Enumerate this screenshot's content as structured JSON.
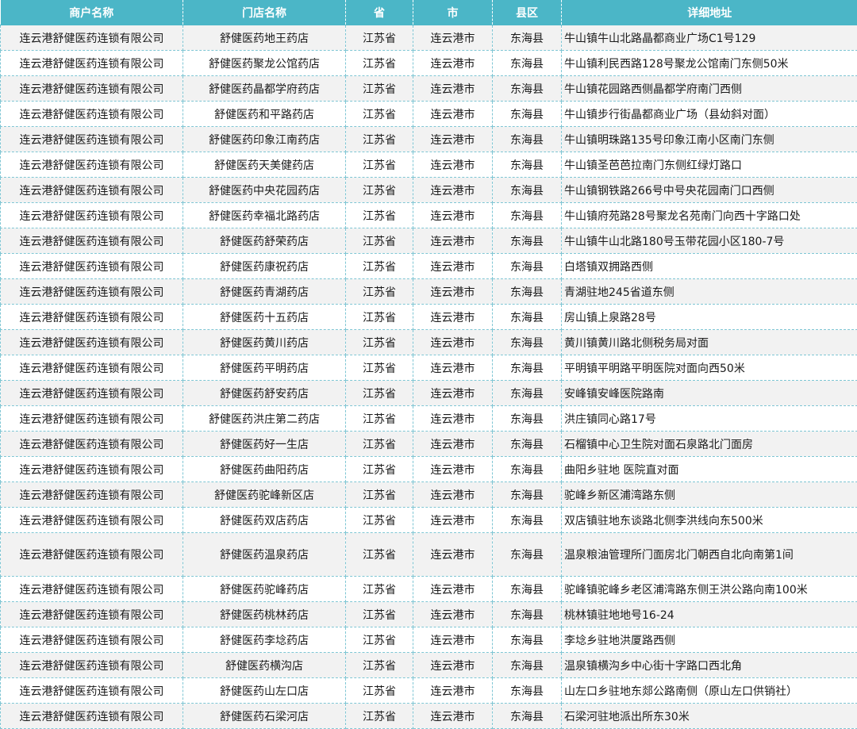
{
  "table": {
    "headers": [
      "商户名称",
      "门店名称",
      "省",
      "市",
      "县区",
      "详细地址"
    ],
    "rows": [
      [
        "连云港舒健医药连锁有限公司",
        "舒健医药地王药店",
        "江苏省",
        "连云港市",
        "东海县",
        "牛山镇牛山北路晶都商业广场C1号129"
      ],
      [
        "连云港舒健医药连锁有限公司",
        "舒健医药聚龙公馆药店",
        "江苏省",
        "连云港市",
        "东海县",
        "牛山镇利民西路128号聚龙公馆南门东侧50米"
      ],
      [
        "连云港舒健医药连锁有限公司",
        "舒健医药晶都学府药店",
        "江苏省",
        "连云港市",
        "东海县",
        "牛山镇花园路西侧晶都学府南门西侧"
      ],
      [
        "连云港舒健医药连锁有限公司",
        "舒健医药和平路药店",
        "江苏省",
        "连云港市",
        "东海县",
        "牛山镇步行街晶都商业广场（县幼斜对面）"
      ],
      [
        "连云港舒健医药连锁有限公司",
        "舒健医药印象江南药店",
        "江苏省",
        "连云港市",
        "东海县",
        "牛山镇明珠路135号印象江南小区南门东侧"
      ],
      [
        "连云港舒健医药连锁有限公司",
        "舒健医药天美健药店",
        "江苏省",
        "连云港市",
        "东海县",
        "牛山镇圣芭芭拉南门东侧红绿灯路口"
      ],
      [
        "连云港舒健医药连锁有限公司",
        "舒健医药中央花园药店",
        "江苏省",
        "连云港市",
        "东海县",
        "牛山镇钢铁路266号中号央花园南门口西侧"
      ],
      [
        "连云港舒健医药连锁有限公司",
        "舒健医药幸福北路药店",
        "江苏省",
        "连云港市",
        "东海县",
        "牛山镇府苑路28号聚龙名苑南门向西十字路口处"
      ],
      [
        "连云港舒健医药连锁有限公司",
        "舒健医药舒荣药店",
        "江苏省",
        "连云港市",
        "东海县",
        "牛山镇牛山北路180号玉带花园小区180-7号"
      ],
      [
        "连云港舒健医药连锁有限公司",
        "舒健医药康祝药店",
        "江苏省",
        "连云港市",
        "东海县",
        "白塔镇双拥路西侧"
      ],
      [
        "连云港舒健医药连锁有限公司",
        "舒健医药青湖药店",
        "江苏省",
        "连云港市",
        "东海县",
        "青湖驻地245省道东侧"
      ],
      [
        "连云港舒健医药连锁有限公司",
        "舒健医药十五药店",
        "江苏省",
        "连云港市",
        "东海县",
        "房山镇上泉路28号"
      ],
      [
        "连云港舒健医药连锁有限公司",
        "舒健医药黄川药店",
        "江苏省",
        "连云港市",
        "东海县",
        "黄川镇黄川路北侧税务局对面"
      ],
      [
        "连云港舒健医药连锁有限公司",
        "舒健医药平明药店",
        "江苏省",
        "连云港市",
        "东海县",
        "平明镇平明路平明医院对面向西50米"
      ],
      [
        "连云港舒健医药连锁有限公司",
        "舒健医药舒安药店",
        "江苏省",
        "连云港市",
        "东海县",
        "安峰镇安峰医院路南"
      ],
      [
        "连云港舒健医药连锁有限公司",
        "舒健医药洪庄第二药店",
        "江苏省",
        "连云港市",
        "东海县",
        "洪庄镇同心路17号"
      ],
      [
        "连云港舒健医药连锁有限公司",
        "舒健医药好一生店",
        "江苏省",
        "连云港市",
        "东海县",
        "石榴镇中心卫生院对面石泉路北门面房"
      ],
      [
        "连云港舒健医药连锁有限公司",
        "舒健医药曲阳药店",
        "江苏省",
        "连云港市",
        "东海县",
        "曲阳乡驻地 医院直对面"
      ],
      [
        "连云港舒健医药连锁有限公司",
        "舒健医药驼峰新区店",
        "江苏省",
        "连云港市",
        "东海县",
        "驼峰乡新区浦湾路东侧"
      ],
      [
        "连云港舒健医药连锁有限公司",
        "舒健医药双店药店",
        "江苏省",
        "连云港市",
        "东海县",
        "双店镇驻地东谈路北侧李洪线向东500米"
      ],
      [
        "连云港舒健医药连锁有限公司",
        "舒健医药温泉药店",
        "江苏省",
        "连云港市",
        "东海县",
        "温泉粮油管理所门面房北门朝西自北向南第1间"
      ],
      [
        "连云港舒健医药连锁有限公司",
        "舒健医药驼峰药店",
        "江苏省",
        "连云港市",
        "东海县",
        "驼峰镇驼峰乡老区浦湾路东侧王洪公路向南100米"
      ],
      [
        "连云港舒健医药连锁有限公司",
        "舒健医药桃林药店",
        "江苏省",
        "连云港市",
        "东海县",
        "桃林镇驻地地号16-24"
      ],
      [
        "连云港舒健医药连锁有限公司",
        "舒健医药李埝药店",
        "江苏省",
        "连云港市",
        "东海县",
        "李埝乡驻地洪厦路西侧"
      ],
      [
        "连云港舒健医药连锁有限公司",
        "舒健医药横沟店",
        "江苏省",
        "连云港市",
        "东海县",
        "温泉镇横沟乡中心街十字路口西北角"
      ],
      [
        "连云港舒健医药连锁有限公司",
        "舒健医药山左口店",
        "江苏省",
        "连云港市",
        "东海县",
        "山左口乡驻地东郯公路南侧（原山左口供销社）"
      ],
      [
        "连云港舒健医药连锁有限公司",
        "舒健医药石梁河店",
        "江苏省",
        "连云港市",
        "东海县",
        "石梁河驻地派出所东30米"
      ]
    ]
  }
}
